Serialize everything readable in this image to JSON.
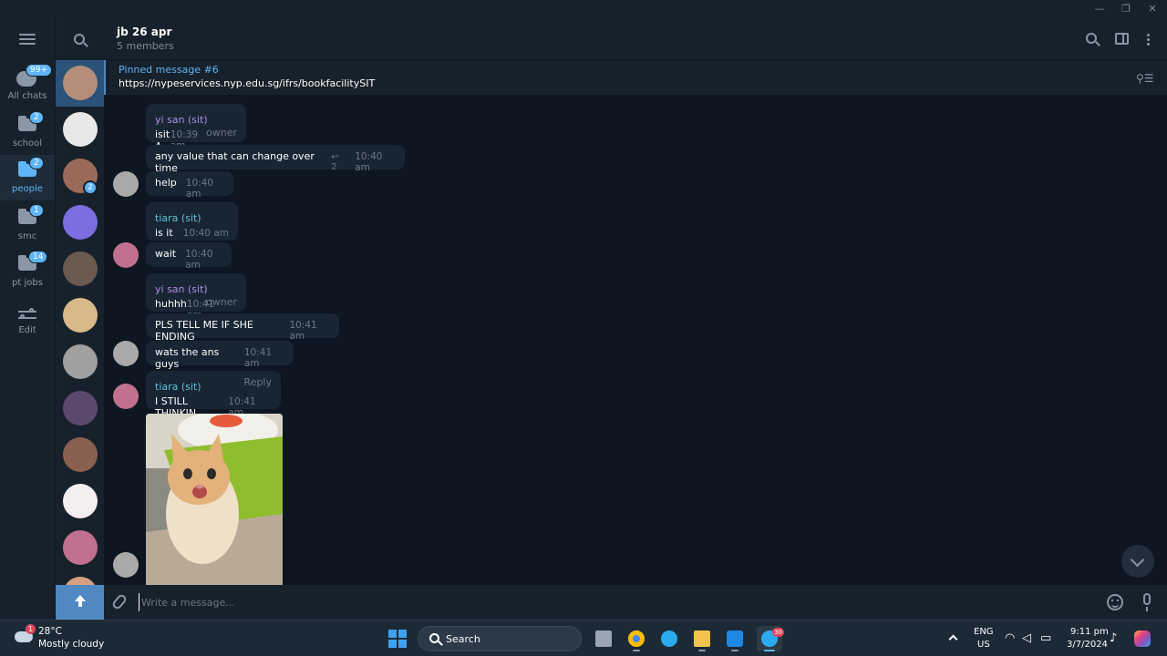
{
  "window": {
    "minimize_glyph": "—",
    "restore_glyph": "❐",
    "close_glyph": "✕"
  },
  "folders": [
    {
      "label": "All chats",
      "badge": "99+",
      "icon": "chat-bubbles-icon",
      "active": false
    },
    {
      "label": "school",
      "badge": "2",
      "icon": "folder-icon",
      "active": false
    },
    {
      "label": "people",
      "badge": "2",
      "icon": "folder-icon",
      "active": true
    },
    {
      "label": "smc",
      "badge": "1",
      "icon": "folder-icon",
      "active": false
    },
    {
      "label": "pt jobs",
      "badge": "14",
      "icon": "folder-icon",
      "active": false
    },
    {
      "label": "Edit",
      "badge": "",
      "icon": "sliders-icon",
      "active": false
    }
  ],
  "chat_list": {
    "avatar_colors": [
      "#b58d7a",
      "#e8e8e8",
      "#9a6b5a",
      "#7c6ee0",
      "#6a5a50",
      "#d9b98a",
      "#a0a0a0",
      "#5c4a6e",
      "#8a6050",
      "#f4eef0",
      "#c27090",
      "#d4a080"
    ],
    "badges": {
      "2": "2"
    }
  },
  "header": {
    "title": "jb 26 apr",
    "subtitle": "5 members"
  },
  "pinned": {
    "title": "Pinned message #6",
    "text": "https://nypeservices.nyp.edu.sg/ifrs/bookfacilitySIT"
  },
  "messages": [
    {
      "sender": "yi san (sit)",
      "role": "owner",
      "text": "isit A",
      "time": "10:39 am"
    },
    {
      "sender": "",
      "role": "",
      "text": "any value that can change over time",
      "replies": "2",
      "time": "10:40 am"
    },
    {
      "sender": "",
      "role": "",
      "text": "help",
      "time": "10:40 am"
    },
    {
      "sender": "tiara (sit)",
      "role": "",
      "text": "is it",
      "time": "10:40 am"
    },
    {
      "sender": "",
      "role": "",
      "text": "wait",
      "time": "10:40 am"
    },
    {
      "sender": "yi san (sit)",
      "role": "owner",
      "text": "huhhh",
      "time": "10:41 am"
    },
    {
      "sender": "",
      "role": "",
      "text": "PLS TELL ME IF SHE ENDING",
      "time": "10:41 am"
    },
    {
      "sender": "",
      "role": "",
      "text": "wats the ans guys",
      "time": "10:41 am"
    },
    {
      "sender": "tiara (sit)",
      "role": "Reply",
      "text": "I STILL THINKIN",
      "time": "10:41 am"
    }
  ],
  "colors": {
    "yi_san": "#b18ee8",
    "tiara": "#5ec3d9",
    "accent": "#5eb5f7"
  },
  "composer": {
    "placeholder": "Write a message..."
  },
  "taskbar": {
    "temperature": "28°C",
    "weather": "Mostly cloudy",
    "weather_badge": "1",
    "search_label": "Search",
    "telegram_badge": "30",
    "lang_top": "ENG",
    "lang_bottom": "US",
    "time": "9:11 pm",
    "date": "3/7/2024"
  }
}
